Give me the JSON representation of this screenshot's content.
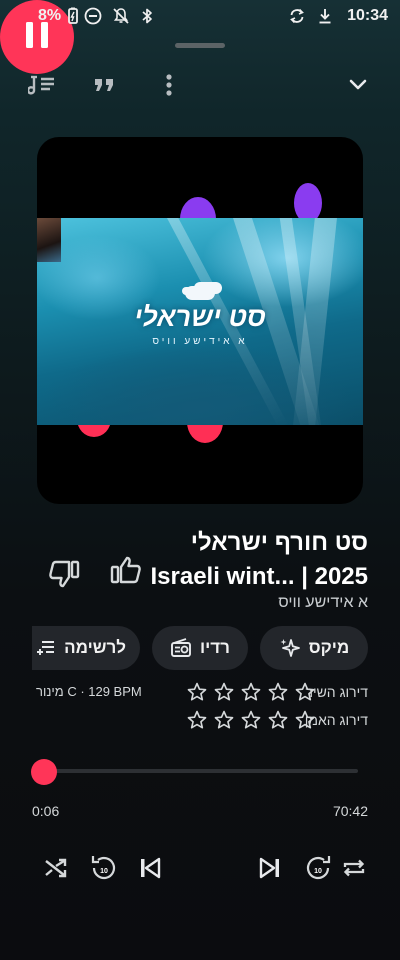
{
  "status_bar": {
    "battery": "8%",
    "time": "10:34",
    "icons": [
      "battery-icon",
      "dnd-icon",
      "notifications-off-icon",
      "bluetooth-icon",
      "sync-icon",
      "download-icon"
    ]
  },
  "top_bar": {
    "icons": [
      "queue-icon",
      "lyrics-quote-icon",
      "more-vert-icon",
      "chevron-down-icon"
    ]
  },
  "artwork": {
    "title_text": "סט ישראלי",
    "subtitle_text": "א אידישע וויס"
  },
  "track": {
    "title_line1": "סט חורף ישראלי",
    "title_line2": "Israeli wint... | 2025",
    "artist": "א אידישע וויס"
  },
  "chips": {
    "mix": "מיקס",
    "radio": "רדיו",
    "playlist": "לרשימה"
  },
  "ratings": {
    "song_label": "דירוג השיר",
    "artist_label": "דירוג האמן",
    "song_stars": 0,
    "artist_stars": 0,
    "max_stars": 5,
    "bpm_info": "C · 129 BPM מינור"
  },
  "progress": {
    "elapsed": "0:06",
    "duration": "70:42",
    "fraction": 0.0014
  },
  "controls": {
    "rewind_seconds": "10",
    "forward_seconds": "10",
    "icons": [
      "shuffle-icon",
      "rewind-10-icon",
      "skip-previous-icon",
      "pause-icon",
      "skip-next-icon",
      "forward-10-icon",
      "repeat-icon"
    ]
  },
  "colors": {
    "accent": "#ff3558",
    "chip_bg": "#23262b",
    "blob_purple": "#8a3cf0",
    "blob_pink": "#ff2f55"
  }
}
